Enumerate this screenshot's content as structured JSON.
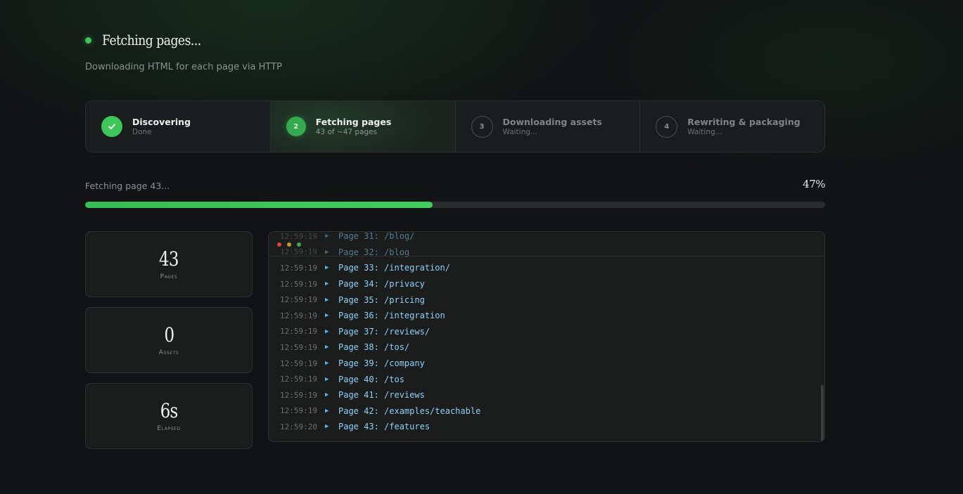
{
  "header": {
    "title": "Fetching pages...",
    "subtitle": "Downloading HTML for each page via HTTP"
  },
  "steps": [
    {
      "number": "1",
      "label": "Discovering",
      "status": "Done",
      "state": "done"
    },
    {
      "number": "2",
      "label": "Fetching pages",
      "status": "43 of ~47 pages",
      "state": "current"
    },
    {
      "number": "3",
      "label": "Downloading assets",
      "status": "Waiting...",
      "state": "waiting"
    },
    {
      "number": "4",
      "label": "Rewriting & packaging",
      "status": "Waiting...",
      "state": "waiting"
    }
  ],
  "progress": {
    "label": "Fetching page 43...",
    "percent_text": "47%",
    "value": 0.47
  },
  "stats": [
    {
      "value": "43",
      "label": "Pages"
    },
    {
      "value": "0",
      "label": "Assets"
    },
    {
      "value": "6s",
      "label": "Elapsed"
    }
  ],
  "log": [
    {
      "time": "12:59:19",
      "message": "Page 31: /blog/"
    },
    {
      "time": "12:59:19",
      "message": "Page 32: /blog"
    },
    {
      "time": "12:59:19",
      "message": "Page 33: /integration/"
    },
    {
      "time": "12:59:19",
      "message": "Page 34: /privacy"
    },
    {
      "time": "12:59:19",
      "message": "Page 35: /pricing"
    },
    {
      "time": "12:59:19",
      "message": "Page 36: /integration"
    },
    {
      "time": "12:59:19",
      "message": "Page 37: /reviews/"
    },
    {
      "time": "12:59:19",
      "message": "Page 38: /tos/"
    },
    {
      "time": "12:59:19",
      "message": "Page 39: /company"
    },
    {
      "time": "12:59:19",
      "message": "Page 40: /tos"
    },
    {
      "time": "12:59:19",
      "message": "Page 41: /reviews"
    },
    {
      "time": "12:59:19",
      "message": "Page 42: /examples/teachable"
    },
    {
      "time": "12:59:20",
      "message": "Page 43: /features"
    }
  ],
  "log_arrow": "▶",
  "colors": {
    "accent": "#3ec55a",
    "background": "#111314",
    "card": "#1b1d1d",
    "log_text": "#8fd0f7"
  },
  "icons": {
    "step_done": "check-icon",
    "log_entry": "play-arrow-icon"
  }
}
